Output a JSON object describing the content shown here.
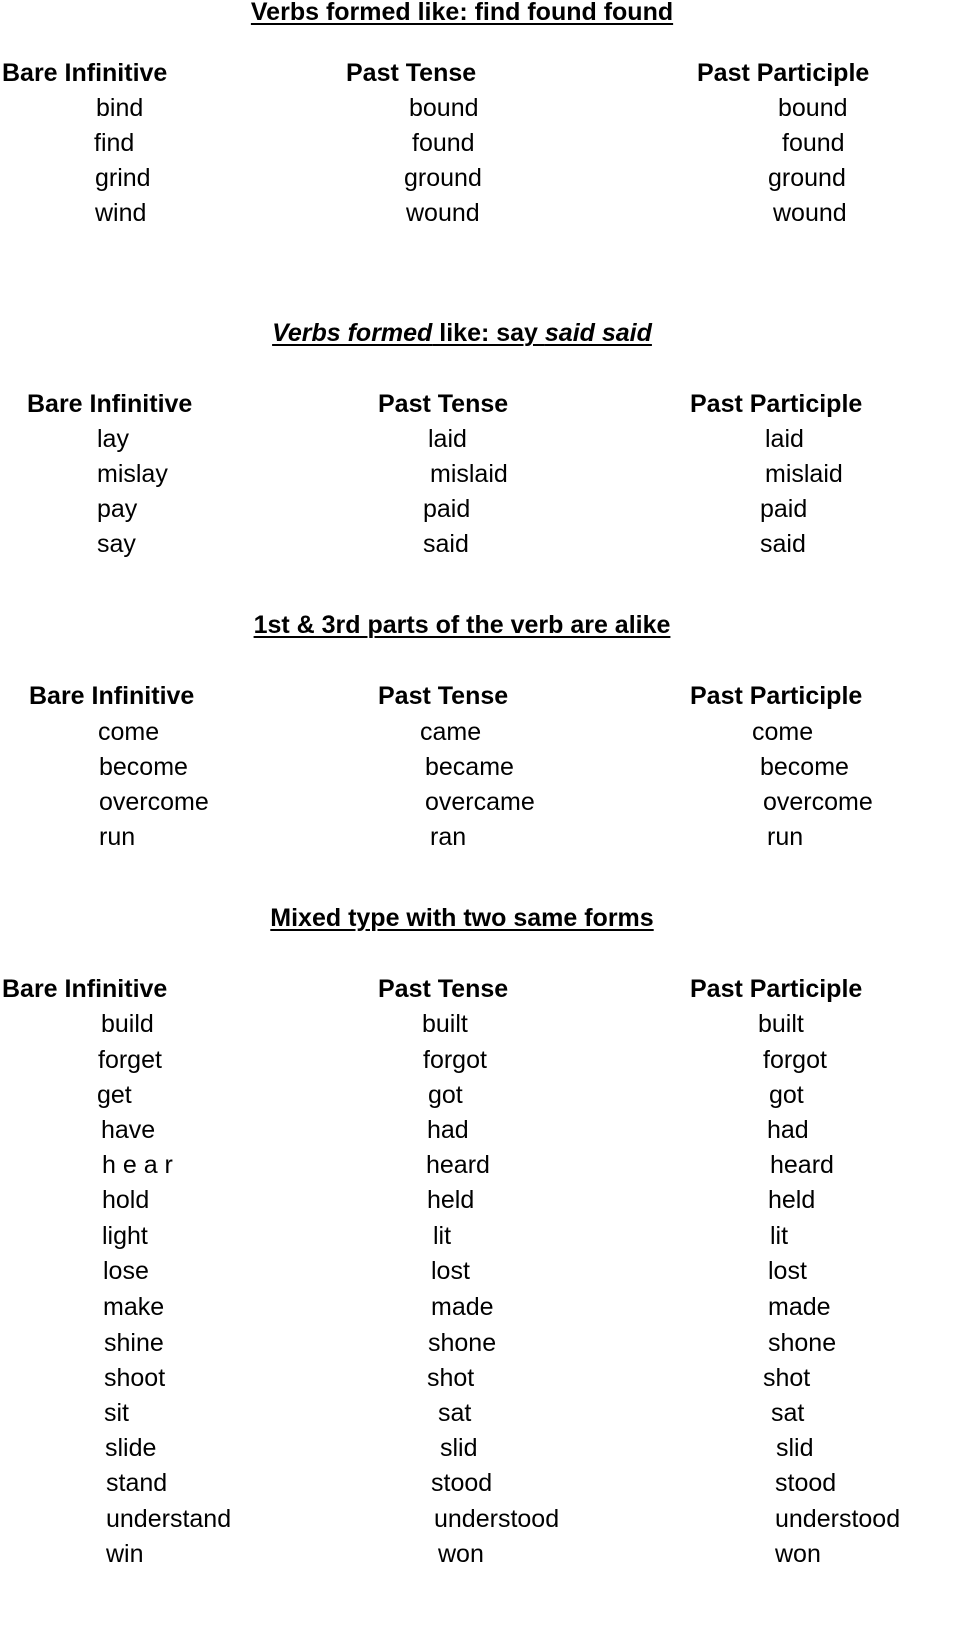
{
  "headers": {
    "bare": "Bare Infinitive",
    "past": "Past Tense",
    "participle": "Past Participle"
  },
  "sections": [
    {
      "title_parts": [
        {
          "text": "Verbs formed like: find found found",
          "italic": false
        }
      ],
      "rows": [
        [
          "bind",
          "bound",
          "bound"
        ],
        [
          "find",
          "found",
          "found"
        ],
        [
          "grind",
          "ground",
          "ground"
        ],
        [
          "wind",
          "wound",
          "wound"
        ]
      ]
    },
    {
      "title_parts": [
        {
          "text": "Verbs formed",
          "italic": true
        },
        {
          "text": " like: say ",
          "italic": false
        },
        {
          "text": "said said",
          "italic": true
        }
      ],
      "rows": [
        [
          "lay",
          "laid",
          "laid"
        ],
        [
          "mislay",
          "mislaid",
          "mislaid"
        ],
        [
          "pay",
          "paid",
          "paid"
        ],
        [
          "say",
          "said",
          "said"
        ]
      ]
    },
    {
      "title_parts": [
        {
          "text": "1st & 3rd parts of the verb are alike",
          "italic": false
        }
      ],
      "rows": [
        [
          "come",
          "came",
          "come"
        ],
        [
          "become",
          "became",
          "become"
        ],
        [
          "overcome",
          "overcame",
          "overcome"
        ],
        [
          "run",
          "ran",
          "run"
        ]
      ]
    },
    {
      "title_parts": [
        {
          "text": "Mixed type with two same forms",
          "italic": false
        }
      ],
      "rows": [
        [
          "build",
          "built",
          "built"
        ],
        [
          "forget",
          "forgot",
          "forgot"
        ],
        [
          "get",
          "got",
          "got"
        ],
        [
          "have",
          "had",
          "had"
        ],
        [
          "h e a r",
          "heard",
          "heard"
        ],
        [
          "hold",
          "held",
          "held"
        ],
        [
          "light",
          "lit",
          "lit"
        ],
        [
          "lose",
          "lost",
          "lost"
        ],
        [
          "make",
          "made",
          "made"
        ],
        [
          "shine",
          "shone",
          "shone"
        ],
        [
          "shoot",
          "shot",
          "shot"
        ],
        [
          "sit",
          "sat",
          "sat"
        ],
        [
          "slide",
          "slid",
          "slid"
        ],
        [
          "stand",
          "stood",
          "stood"
        ],
        [
          "understand",
          "understood",
          "understood"
        ],
        [
          "win",
          "won",
          "won"
        ]
      ]
    }
  ]
}
